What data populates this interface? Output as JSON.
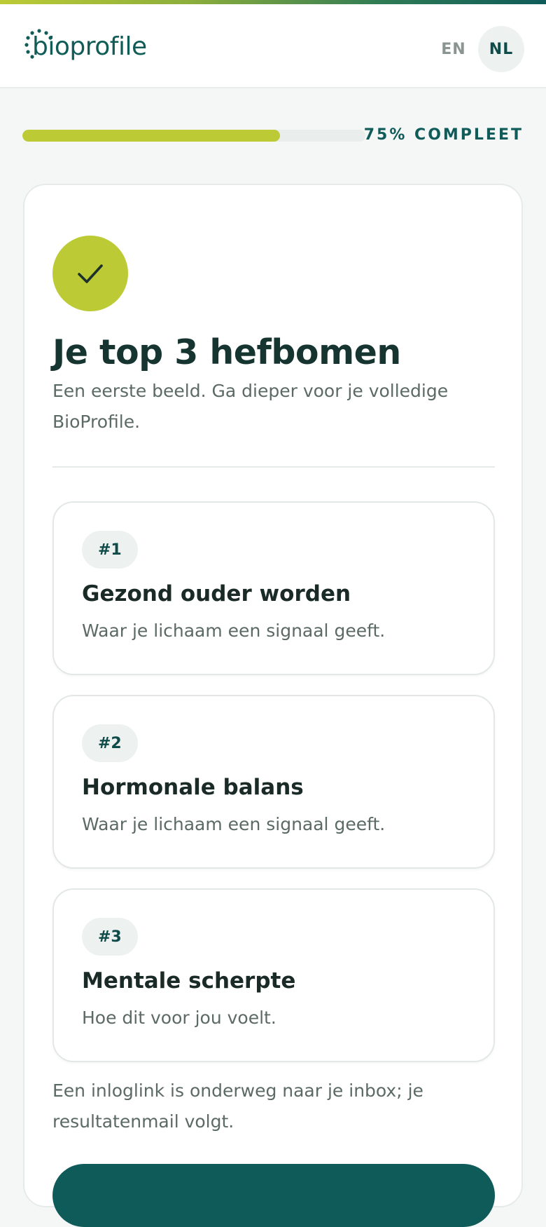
{
  "header": {
    "logo_text": "bioprofile",
    "languages": [
      {
        "code": "EN",
        "active": false
      },
      {
        "code": "NL",
        "active": true
      }
    ]
  },
  "progress": {
    "percent": 75,
    "label": "75% COMPLEET"
  },
  "card": {
    "icon": "check-icon",
    "title": "Je top 3 hefbomen",
    "subtitle": "Een eerste beeld. Ga dieper voor je volledige BioProfile.",
    "levers": [
      {
        "rank": "#1",
        "title": "Gezond ouder worden",
        "description": "Waar je lichaam een signaal geeft."
      },
      {
        "rank": "#2",
        "title": "Hormonale balans",
        "description": "Waar je lichaam een signaal geeft."
      },
      {
        "rank": "#3",
        "title": "Mentale scherpte",
        "description": "Hoe dit voor jou voelt."
      }
    ],
    "note": "Een inloglink is onderweg naar je inbox; je resultatenmail volgt."
  },
  "colors": {
    "brand": "#0f5b5a",
    "accent": "#bccb35"
  }
}
